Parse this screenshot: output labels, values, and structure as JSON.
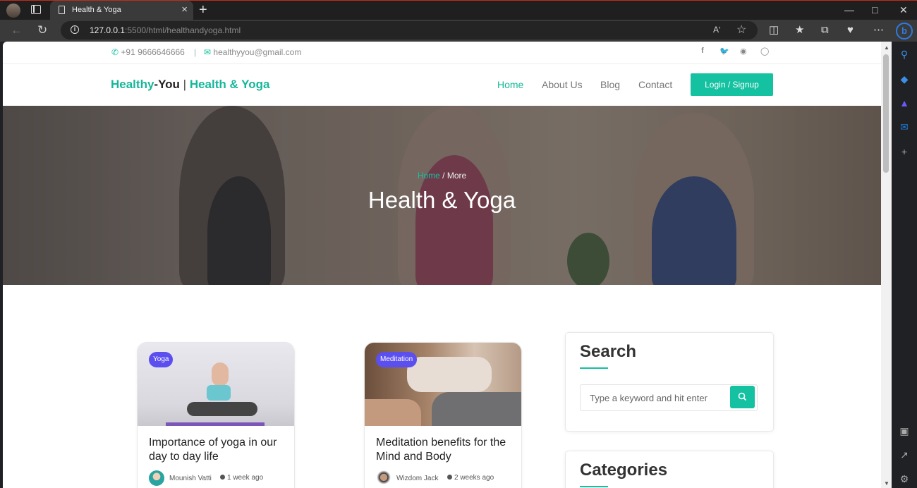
{
  "browser": {
    "tab_title": "Health & Yoga",
    "url_host": "127.0.0.1",
    "url_path": ":5500/html/healthandyoga.html",
    "read_aloud": "Aʹ",
    "window_controls": [
      "—",
      "□",
      "✕"
    ],
    "new_tab": "+",
    "close_tab": "×"
  },
  "contact": {
    "phone": "+91 9666646666",
    "separator": "|",
    "email": "healthyyou@gmail.com",
    "social_icons": [
      "facebook-icon",
      "twitter-icon",
      "github-icon",
      "instagram-icon"
    ]
  },
  "nav": {
    "brand_part1": "Healthy",
    "brand_part2": "-You",
    "brand_sep": " | ",
    "brand_part3": "Health & Yoga",
    "links": [
      "Home",
      "About Us",
      "Blog",
      "Contact"
    ],
    "login": "Login / Signup"
  },
  "hero": {
    "crumb_home": "Home",
    "crumb_sep": " / ",
    "crumb_current": "More",
    "title": "Health & Yoga"
  },
  "posts": [
    {
      "badge": "Yoga",
      "title": "Importance of yoga in our day to day life",
      "author": "Mounish Vatti",
      "time": "1 week ago"
    },
    {
      "badge": "Meditation",
      "title": "Meditation benefits for the Mind and Body",
      "author": "Wizdom Jack",
      "time": "2 weeks ago"
    }
  ],
  "sidebar": {
    "search_title": "Search",
    "search_placeholder": "Type a keyword and hit enter",
    "categories_title": "Categories"
  },
  "colors": {
    "accent": "#14c1a0",
    "badge": "#5b4ff0"
  }
}
